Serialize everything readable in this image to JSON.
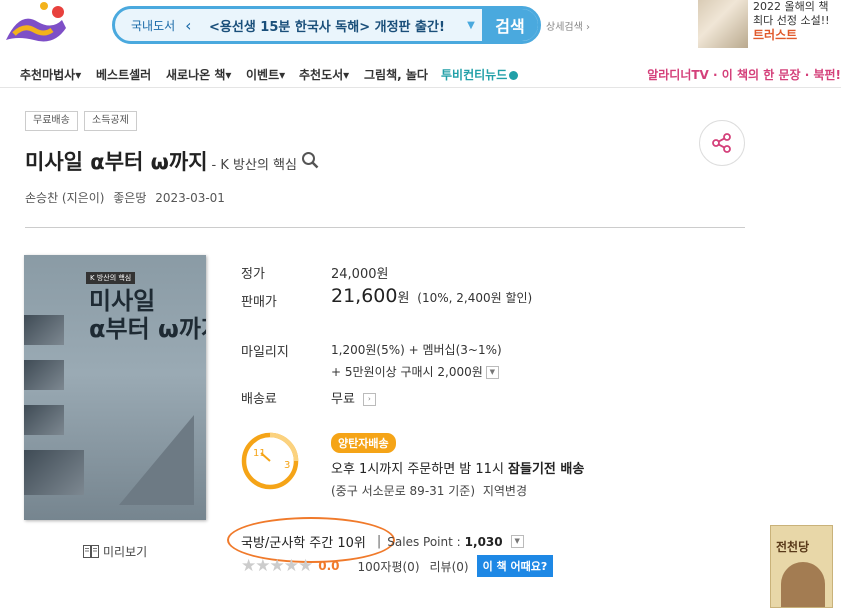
{
  "header": {
    "search": {
      "category": "국내도서",
      "value": "<용선생 15분 한국사 독해> 개정판 출간!",
      "button": "검색"
    },
    "detail_search": "상세검색",
    "promo": {
      "line1": "2022 올해의 책",
      "line2": "최다 선정 소설!!",
      "line3": "트러스트"
    }
  },
  "nav": {
    "items": [
      "추천마법사",
      "베스트셀러",
      "새로나온 책",
      "이벤트",
      "추천도서",
      "그림책, 놀다",
      "투비컨티뉴드"
    ],
    "right": "알라디너TV · 이 책의 한 문장 · 북펀!"
  },
  "product": {
    "badges": [
      "무료배송",
      "소득공제"
    ],
    "title": "미사일 α부터 ω까지",
    "subtitle": "- K 방산의 핵심",
    "author": "손승찬 (지은이)",
    "publisher": "좋은땅",
    "date": "2023-03-01",
    "cover": {
      "tag": "K 방산의 핵심",
      "title_line1": "미사일",
      "title_line2": "α부터 ω까지"
    },
    "preview": "미리보기"
  },
  "price": {
    "list_label": "정가",
    "list_value": "24,000원",
    "sale_label": "판매가",
    "sale_value": "21,600",
    "sale_unit": "원",
    "sale_note": "(10%, 2,400원 할인)",
    "mileage_label": "마일리지",
    "mileage_line1": "1,200원(5%) + 멤버십(3~1%)",
    "mileage_line2": "+ 5만원이상 구매시 2,000원",
    "ship_label": "배송료",
    "ship_value": "무료"
  },
  "delivery": {
    "clock_left": "11",
    "clock_right": "3",
    "badge": "양탄자배송",
    "line1_pre": "오후 1시까지 주문하면 밤 11시 ",
    "line1_bold": "잠들기전 배송",
    "line2": "(중구 서소문로 89-31 기준)",
    "change": "지역변경"
  },
  "rank": {
    "text": "국방/군사학 주간 10위",
    "sep": "|",
    "sales_label": "Sales Point :",
    "sales_value": "1,030"
  },
  "rating": {
    "score": "0.0",
    "stars_filled": 0,
    "reviews_100": "100자평(0)",
    "reviews": "리뷰(0)",
    "button": "이 책 어때요?"
  },
  "side_ad": {
    "title": "전천당"
  },
  "colors": {
    "accent_blue": "#4aa9de",
    "orange": "#f07a2b",
    "pill": "#f5a417",
    "nav_pink": "#d4407a",
    "teal": "#21a0a8"
  }
}
